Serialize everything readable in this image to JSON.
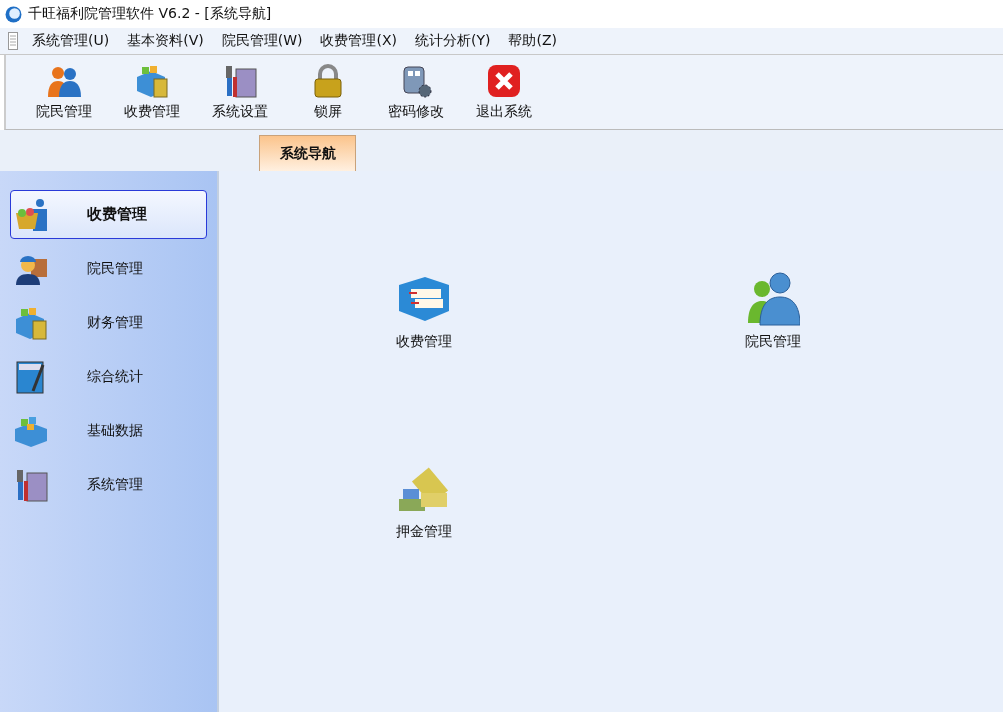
{
  "window": {
    "title": "千旺福利院管理软件 V6.2 - [系统导航]"
  },
  "menu_bar": [
    "系统管理(U)",
    "基本资料(V)",
    "院民管理(W)",
    "收费管理(X)",
    "统计分析(Y)",
    "帮助(Z)"
  ],
  "toolbar": [
    "院民管理",
    "收费管理",
    "系统设置",
    "锁屏",
    "密码修改",
    "退出系统"
  ],
  "tabs": [
    {
      "label": "系统导航",
      "selected": true
    }
  ],
  "sidebar": {
    "items": [
      {
        "label": "收费管理",
        "selected": true
      },
      {
        "label": "院民管理",
        "selected": false
      },
      {
        "label": "财务管理",
        "selected": false
      },
      {
        "label": "综合统计",
        "selected": false
      },
      {
        "label": "基础数据",
        "selected": false
      },
      {
        "label": "系统管理",
        "selected": false
      }
    ]
  },
  "launchers": [
    {
      "label": "收费管理"
    },
    {
      "label": "院民管理"
    },
    {
      "label": "押金管理"
    }
  ]
}
